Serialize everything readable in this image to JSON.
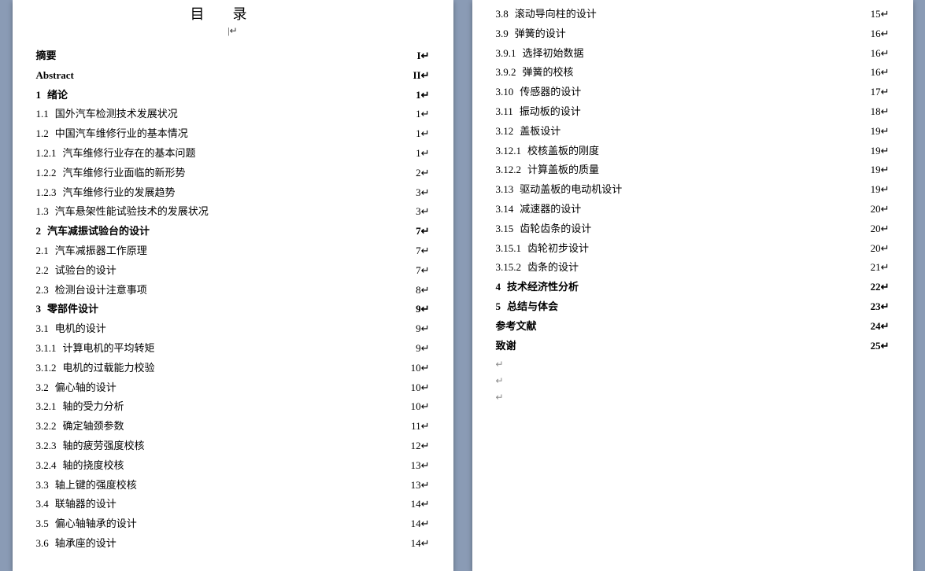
{
  "title": "目录",
  "left_page": [
    {
      "num": "",
      "text": "摘要",
      "page": "I",
      "bold": true,
      "indent": 1
    },
    {
      "num": "",
      "text": "Abstract",
      "page": "II",
      "bold": true,
      "indent": 1
    },
    {
      "num": "1",
      "text": "绪论",
      "page": "1",
      "bold": true,
      "indent": 1
    },
    {
      "num": "1.1",
      "text": "国外汽车检测技术发展状况",
      "page": "1",
      "bold": false,
      "indent": 2
    },
    {
      "num": "1.2",
      "text": "中国汽车维修行业的基本情况",
      "page": "1",
      "bold": false,
      "indent": 2
    },
    {
      "num": "1.2.1",
      "text": "汽车维修行业存在的基本问题",
      "page": "1",
      "bold": false,
      "indent": 3
    },
    {
      "num": "1.2.2",
      "text": "汽车维修行业面临的新形势",
      "page": "2",
      "bold": false,
      "indent": 3
    },
    {
      "num": "1.2.3",
      "text": "汽车维修行业的发展趋势",
      "page": "3",
      "bold": false,
      "indent": 3
    },
    {
      "num": "1.3",
      "text": "汽车悬架性能试验技术的发展状况",
      "page": "3",
      "bold": false,
      "indent": 2
    },
    {
      "num": "2",
      "text": "汽车减振试验台的设计",
      "page": "7",
      "bold": true,
      "indent": 1
    },
    {
      "num": "2.1",
      "text": "汽车减振器工作原理",
      "page": "7",
      "bold": false,
      "indent": 2
    },
    {
      "num": "2.2",
      "text": "试验台的设计",
      "page": "7",
      "bold": false,
      "indent": 2
    },
    {
      "num": "2.3",
      "text": "检测台设计注意事项",
      "page": "8",
      "bold": false,
      "indent": 2
    },
    {
      "num": "3",
      "text": "零部件设计",
      "page": "9",
      "bold": true,
      "indent": 1
    },
    {
      "num": "3.1",
      "text": "电机的设计",
      "page": "9",
      "bold": false,
      "indent": 2
    },
    {
      "num": "3.1.1",
      "text": "计算电机的平均转矩",
      "page": "9",
      "bold": false,
      "indent": 3
    },
    {
      "num": "3.1.2",
      "text": "电机的过载能力校验",
      "page": "10",
      "bold": false,
      "indent": 3
    },
    {
      "num": "3.2",
      "text": "偏心轴的设计",
      "page": "10",
      "bold": false,
      "indent": 2
    },
    {
      "num": "3.2.1",
      "text": "轴的受力分析",
      "page": "10",
      "bold": false,
      "indent": 3
    },
    {
      "num": "3.2.2",
      "text": "确定轴颈参数",
      "page": "11",
      "bold": false,
      "indent": 3
    },
    {
      "num": "3.2.3",
      "text": "轴的疲劳强度校核",
      "page": "12",
      "bold": false,
      "indent": 3
    },
    {
      "num": "3.2.4",
      "text": "轴的挠度校核",
      "page": "13",
      "bold": false,
      "indent": 3
    },
    {
      "num": "3.3",
      "text": "轴上键的强度校核",
      "page": "13",
      "bold": false,
      "indent": 2
    },
    {
      "num": "3.4",
      "text": "联轴器的设计",
      "page": "14",
      "bold": false,
      "indent": 2
    },
    {
      "num": "3.5",
      "text": "偏心轴轴承的设计",
      "page": "14",
      "bold": false,
      "indent": 2
    },
    {
      "num": "3.6",
      "text": "轴承座的设计",
      "page": "14",
      "bold": false,
      "indent": 2
    }
  ],
  "right_page": [
    {
      "num": "3.8",
      "text": "滚动导向柱的设计",
      "page": "15",
      "bold": false,
      "indent": 2
    },
    {
      "num": "3.9",
      "text": "弹簧的设计",
      "page": "16",
      "bold": false,
      "indent": 2
    },
    {
      "num": "3.9.1",
      "text": "选择初始数据",
      "page": "16",
      "bold": false,
      "indent": 3
    },
    {
      "num": "3.9.2",
      "text": "弹簧的校核",
      "page": "16",
      "bold": false,
      "indent": 3
    },
    {
      "num": "3.10",
      "text": "传感器的设计",
      "page": "17",
      "bold": false,
      "indent": 2
    },
    {
      "num": "3.11",
      "text": "振动板的设计",
      "page": "18",
      "bold": false,
      "indent": 2
    },
    {
      "num": "3.12",
      "text": "盖板设计",
      "page": "19",
      "bold": false,
      "indent": 2
    },
    {
      "num": "3.12.1",
      "text": "校核盖板的刚度",
      "page": "19",
      "bold": false,
      "indent": 3
    },
    {
      "num": "3.12.2",
      "text": "计算盖板的质量",
      "page": "19",
      "bold": false,
      "indent": 3
    },
    {
      "num": "3.13",
      "text": "驱动盖板的电动机设计",
      "page": "19",
      "bold": false,
      "indent": 2
    },
    {
      "num": "3.14",
      "text": "减速器的设计",
      "page": "20",
      "bold": false,
      "indent": 2
    },
    {
      "num": "3.15",
      "text": "齿轮齿条的设计",
      "page": "20",
      "bold": false,
      "indent": 2
    },
    {
      "num": "3.15.1",
      "text": "齿轮初步设计",
      "page": "20",
      "bold": false,
      "indent": 3
    },
    {
      "num": "3.15.2",
      "text": "齿条的设计",
      "page": "21",
      "bold": false,
      "indent": 3
    },
    {
      "num": "4",
      "text": "技术经济性分析",
      "page": "22",
      "bold": true,
      "indent": 1
    },
    {
      "num": "5",
      "text": "总结与体会",
      "page": "23",
      "bold": true,
      "indent": 1
    },
    {
      "num": "",
      "text": "参考文献",
      "page": "24",
      "bold": true,
      "indent": 1
    },
    {
      "num": "",
      "text": "致谢",
      "page": "25",
      "bold": true,
      "indent": 1
    }
  ]
}
